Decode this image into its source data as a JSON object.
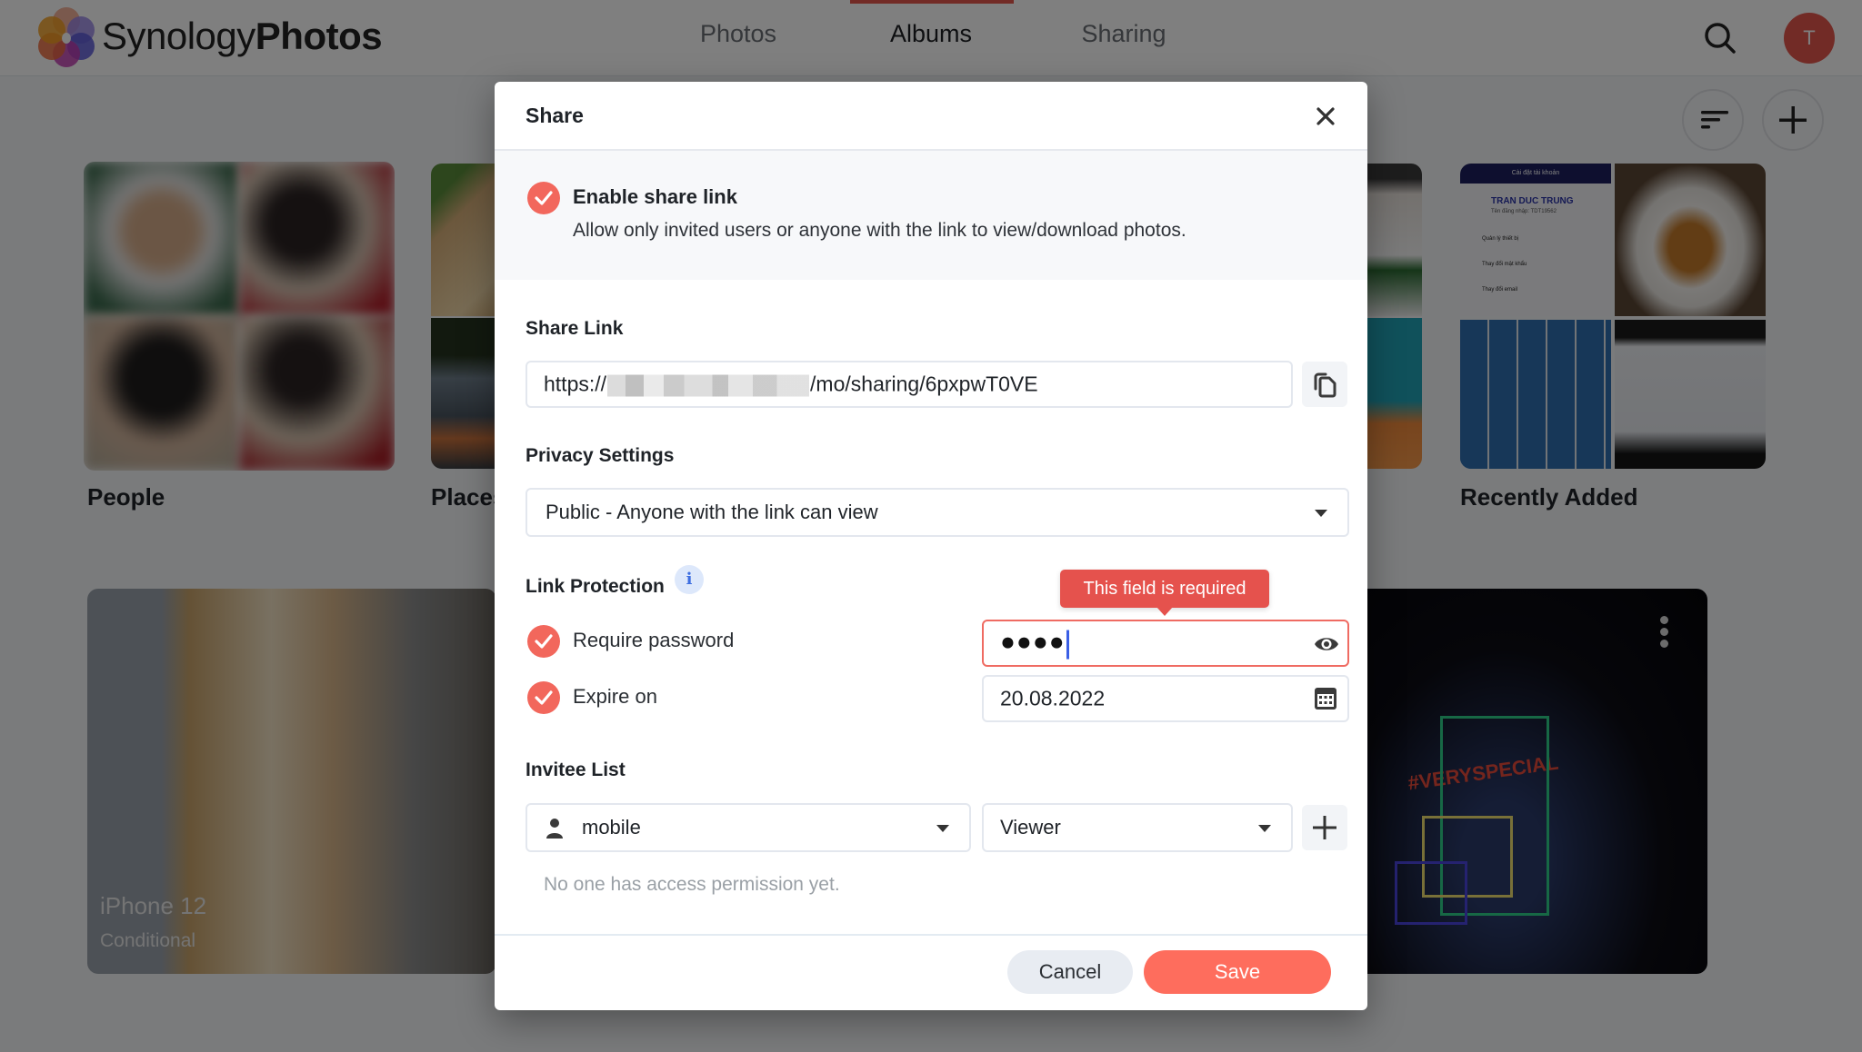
{
  "app": {
    "brand_light": "Synology",
    "brand_bold": "Photos",
    "accent_color": "#f2675c",
    "nav_tabs": [
      {
        "label": "Photos",
        "active": false
      },
      {
        "label": "Albums",
        "active": true
      },
      {
        "label": "Sharing",
        "active": false
      }
    ],
    "avatar_initial": "T",
    "icons": {
      "search": "search-icon",
      "sort": "sort-icon",
      "add": "plus-icon"
    }
  },
  "albums": {
    "row1": [
      {
        "title": "People"
      },
      {
        "title": "Places"
      },
      {
        "title": "Recently Added"
      }
    ],
    "row2": [
      {
        "title": "iPhone 12",
        "subtitle": "Conditional"
      }
    ],
    "screenshot_tile_text": {
      "header": "Cài đặt tài khoản",
      "name": "TRAN DUC TRUNG",
      "login": "Tên đăng nhập: TDT19562",
      "rows": [
        "Quản lý thiết bị",
        "Thay đổi mật khẩu",
        "Thay đổi email"
      ]
    },
    "night_tile_text": "#VERYSPECIAL"
  },
  "dialog": {
    "title": "Share",
    "enable": {
      "checked": true,
      "label": "Enable share link",
      "description": "Allow only invited users or anyone with the link to view/download photos."
    },
    "share_link": {
      "label": "Share Link",
      "prefix": "https://",
      "suffix": "/mo/sharing/6pxpwT0VE",
      "redacted": true
    },
    "privacy": {
      "label": "Privacy Settings",
      "selected": "Public - Anyone with the link can view"
    },
    "link_protection": {
      "label": "Link Protection",
      "info_glyph": "i",
      "require_password": {
        "checked": true,
        "label": "Require password",
        "masked_value": "●●●●",
        "error": "This field is required"
      },
      "expire_on": {
        "checked": true,
        "label": "Expire on",
        "value": "20.08.2022"
      }
    },
    "invitee": {
      "label": "Invitee List",
      "user_selected": "mobile",
      "role_selected": "Viewer",
      "empty_message": "No one has access permission yet."
    },
    "buttons": {
      "cancel": "Cancel",
      "save": "Save"
    }
  }
}
